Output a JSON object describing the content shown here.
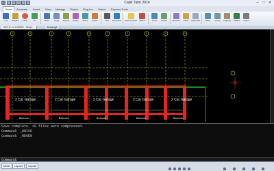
{
  "window": {
    "title": "Cadd Tutor 2014",
    "controls": [
      "─",
      "□",
      "✕"
    ]
  },
  "ribbon_tabs": [
    "Home",
    "Annotate",
    "Insert",
    "View",
    "Manage",
    "Output",
    "Plug-ins",
    "Online",
    "Express Tools"
  ],
  "active_tab": "Home",
  "ribbon_buttons": [
    "Line",
    "Polyline",
    "Circle",
    "Arc",
    "Move",
    "Copy",
    "Stretch",
    "Rotate",
    "Mirror",
    "Scale",
    "Text",
    "Dimension",
    "Layer Properties",
    "Match",
    "Insert",
    "Create",
    "Measure",
    "Paste",
    "Clipboard",
    "Base",
    "Group",
    "Ungroup",
    "Utilities",
    "Select"
  ],
  "doc_tabs": [
    "A03 11-14 LOWER - Sheet...",
    "Drawing1"
  ],
  "drawing": {
    "garage_label": "2 Car Garage",
    "bedroom_label": "Bedroom",
    "grid_bubbles": [
      "A",
      "B",
      "C",
      "D",
      "E",
      "F",
      "G",
      "H",
      "J",
      "K",
      "L",
      "M"
    ]
  },
  "command": {
    "lines": [
      "Save complete. 18 files were compressed.",
      "Command: _UNISO",
      "Command: _REGEN"
    ],
    "prompt": "Command:"
  },
  "status": {
    "layout_tabs": [
      "Model",
      "Layout1",
      "Layout2"
    ]
  },
  "colors": {
    "wall": "#e8241c",
    "floor": "#1fae2a",
    "dim": "#d6d61a",
    "annotation": "#ffffff"
  }
}
